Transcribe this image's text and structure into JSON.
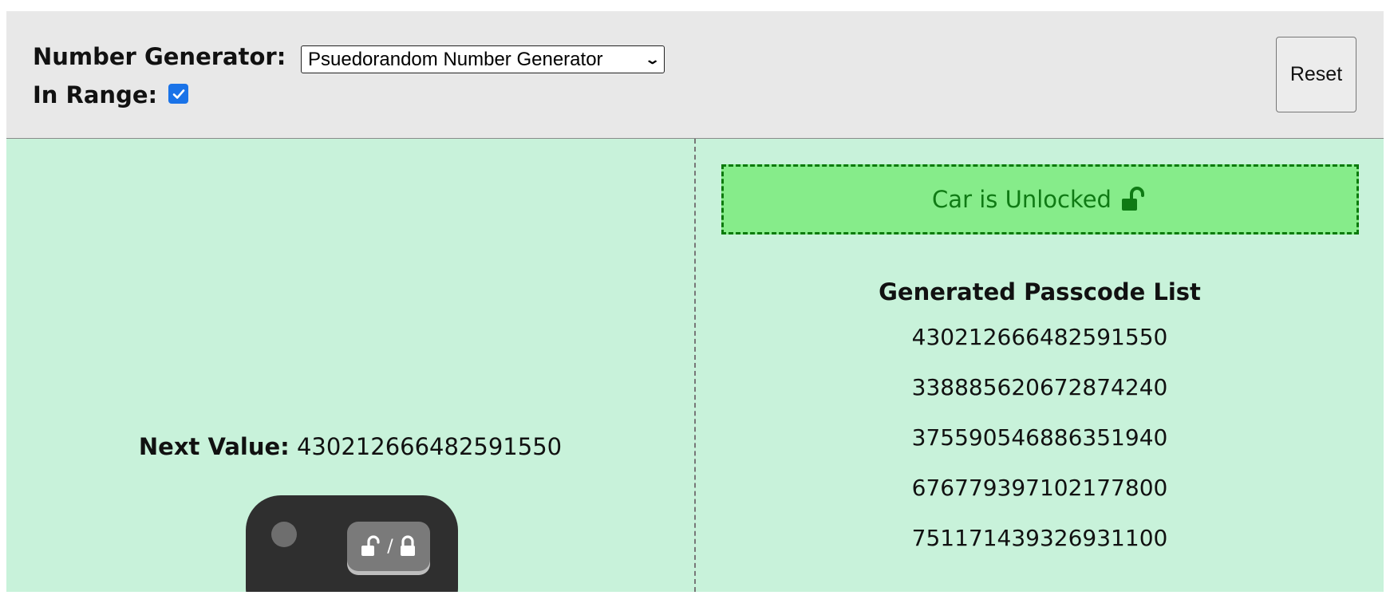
{
  "header": {
    "generator_label": "Number Generator:",
    "generator_selected": "Psuedorandom Number Generator",
    "range_label": "In Range:",
    "range_checked": true,
    "reset_label": "Reset"
  },
  "left_panel": {
    "next_value_label": "Next Value:",
    "next_value": "430212666482591550"
  },
  "right_panel": {
    "status_text": "Car is Unlocked",
    "status_icon": "unlocked-padlock-icon",
    "status_colors": {
      "border": "#0b7a0b",
      "background": "#86ec8a",
      "text": "#0f7a14"
    },
    "list_title": "Generated Passcode List",
    "passcodes": [
      "430212666482591550",
      "338885620672874240",
      "375590546886351940",
      "676779397102177800",
      "751171439326931100"
    ]
  },
  "colors": {
    "header_bg": "#e8e8e8",
    "main_bg": "#c8f2da",
    "fob_body": "#2f2f2f",
    "checkbox_accent": "#1a73e8"
  }
}
